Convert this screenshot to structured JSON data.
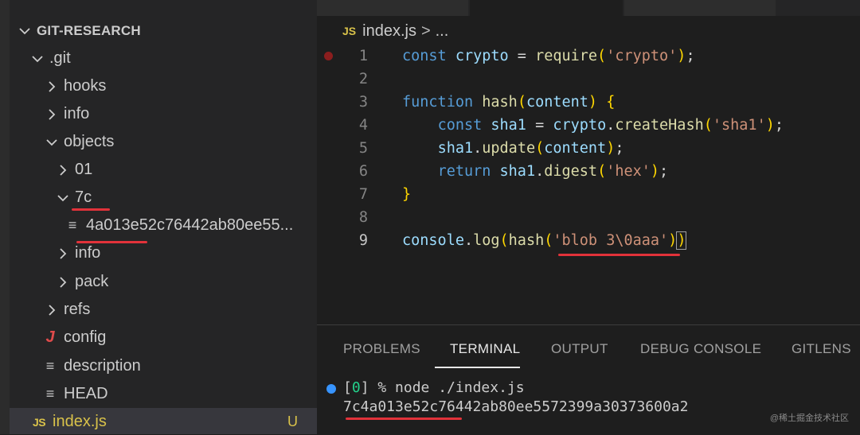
{
  "explorer": {
    "root": "GIT-RESEARCH",
    "items": [
      {
        "label": ".git"
      },
      {
        "label": "hooks"
      },
      {
        "label": "info"
      },
      {
        "label": "objects"
      },
      {
        "label": "01"
      },
      {
        "label": "7c"
      },
      {
        "label": "4a013e52c76442ab80ee55..."
      },
      {
        "label": "info"
      },
      {
        "label": "pack"
      },
      {
        "label": "refs"
      },
      {
        "label": "config"
      },
      {
        "label": "description"
      },
      {
        "label": "HEAD"
      },
      {
        "label": "index.js",
        "badge": "U"
      }
    ]
  },
  "editor": {
    "breadcrumb": {
      "js_badge": "JS",
      "file": "index.js",
      "sep": ">",
      "more": "..."
    },
    "lines": [
      {
        "n": "1",
        "t": [
          [
            "kw",
            "const "
          ],
          [
            "vr",
            "crypto"
          ],
          [
            "pn",
            " = "
          ],
          [
            "fn",
            "require"
          ],
          [
            "br",
            "("
          ],
          [
            "st",
            "'crypto'"
          ],
          [
            "br",
            ")"
          ],
          [
            "pn",
            ";"
          ]
        ]
      },
      {
        "n": "2",
        "t": []
      },
      {
        "n": "3",
        "t": [
          [
            "kw",
            "function "
          ],
          [
            "fn",
            "hash"
          ],
          [
            "br",
            "("
          ],
          [
            "vr",
            "content"
          ],
          [
            "br",
            ")"
          ],
          [
            "pn",
            " "
          ],
          [
            "br",
            "{"
          ]
        ]
      },
      {
        "n": "4",
        "t": [
          [
            "pn",
            "    "
          ],
          [
            "kw",
            "const "
          ],
          [
            "vr",
            "sha1"
          ],
          [
            "pn",
            " = "
          ],
          [
            "vr",
            "crypto"
          ],
          [
            "pn",
            "."
          ],
          [
            "fn",
            "createHash"
          ],
          [
            "br",
            "("
          ],
          [
            "st",
            "'sha1'"
          ],
          [
            "br",
            ")"
          ],
          [
            "pn",
            ";"
          ]
        ]
      },
      {
        "n": "5",
        "t": [
          [
            "pn",
            "    "
          ],
          [
            "vr",
            "sha1"
          ],
          [
            "pn",
            "."
          ],
          [
            "fn",
            "update"
          ],
          [
            "br",
            "("
          ],
          [
            "vr",
            "content"
          ],
          [
            "br",
            ")"
          ],
          [
            "pn",
            ";"
          ]
        ]
      },
      {
        "n": "6",
        "t": [
          [
            "pn",
            "    "
          ],
          [
            "kw",
            "return "
          ],
          [
            "vr",
            "sha1"
          ],
          [
            "pn",
            "."
          ],
          [
            "fn",
            "digest"
          ],
          [
            "br",
            "("
          ],
          [
            "st",
            "'hex'"
          ],
          [
            "br",
            ")"
          ],
          [
            "pn",
            ";"
          ]
        ]
      },
      {
        "n": "7",
        "t": [
          [
            "br",
            "}"
          ]
        ]
      },
      {
        "n": "8",
        "t": []
      },
      {
        "n": "9",
        "t": [
          [
            "vr",
            "console"
          ],
          [
            "pn",
            "."
          ],
          [
            "fn",
            "log"
          ],
          [
            "br",
            "("
          ],
          [
            "fn",
            "hash"
          ],
          [
            "br",
            "("
          ],
          [
            "st",
            "'blob 3\\0aaa'"
          ],
          [
            "br",
            ")"
          ],
          [
            "box",
            ")"
          ]
        ]
      }
    ]
  },
  "panel": {
    "tabs": [
      "PROBLEMS",
      "TERMINAL",
      "OUTPUT",
      "DEBUG CONSOLE",
      "GITLENS"
    ],
    "terminal": {
      "prompt_prefix": "[",
      "prompt_num": "0",
      "prompt_rest": "] % node ./index.js",
      "output": "7c4a013e52c76442ab80ee5572399a30373600a2"
    }
  },
  "watermark": "@稀土掘金技术社区",
  "colors": {
    "underline": "#e2323a",
    "js": "#d9c24a",
    "breakpoint": "#8b1e1e",
    "terminal_dot": "#3794ff"
  }
}
